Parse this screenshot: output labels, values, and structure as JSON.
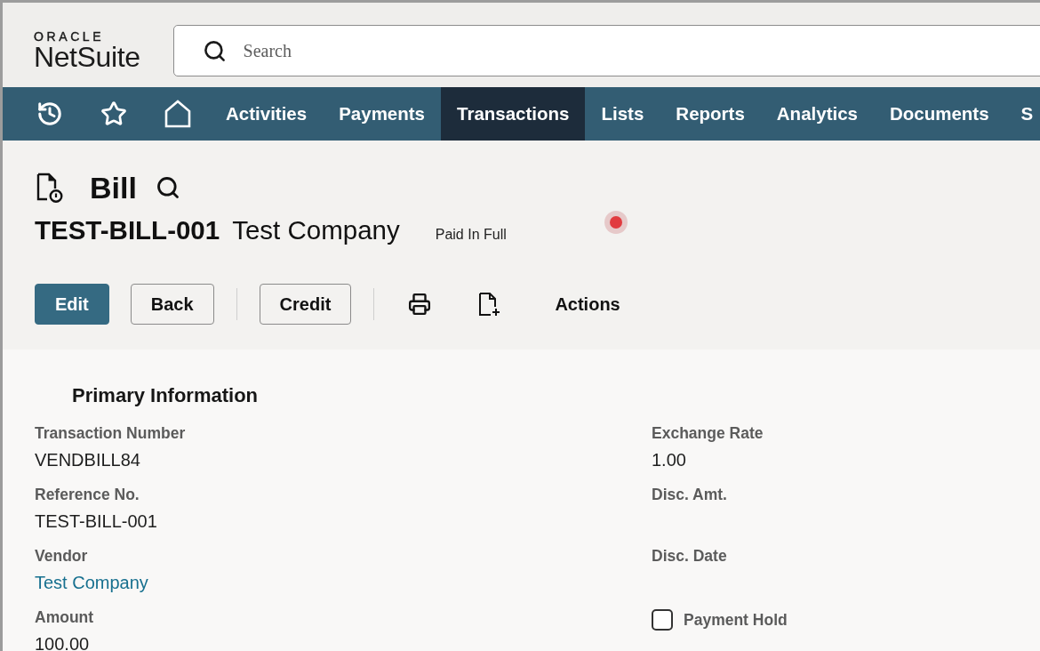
{
  "logo": {
    "caption": "ORACLE",
    "name": "NetSuite"
  },
  "search": {
    "placeholder": "Search"
  },
  "nav": {
    "items": [
      {
        "label": "Activities",
        "selected": false
      },
      {
        "label": "Payments",
        "selected": false
      },
      {
        "label": "Transactions",
        "selected": true
      },
      {
        "label": "Lists",
        "selected": false
      },
      {
        "label": "Reports",
        "selected": false
      },
      {
        "label": "Analytics",
        "selected": false
      },
      {
        "label": "Documents",
        "selected": false
      },
      {
        "label": "S",
        "selected": false
      }
    ]
  },
  "record": {
    "type": "Bill",
    "number": "TEST-BILL-001",
    "entity": "Test Company",
    "status": "Paid In Full"
  },
  "toolbar": {
    "buttons": [
      {
        "label": "Edit",
        "kind": "primary"
      },
      {
        "label": "Back",
        "kind": "secondary"
      },
      {
        "label": "Credit",
        "kind": "secondary"
      }
    ],
    "menu": "Actions"
  },
  "section": {
    "title": "Primary Information",
    "columns": [
      {
        "fields": [
          {
            "kind": "text",
            "label": "Transaction Number",
            "value": "VENDBILL84"
          },
          {
            "kind": "text",
            "label": "Reference No.",
            "value": "TEST-BILL-001"
          },
          {
            "kind": "link",
            "label": "Vendor",
            "value": "Test Company"
          },
          {
            "kind": "text",
            "label": "Amount",
            "value": "100.00"
          }
        ]
      },
      {
        "fields": [
          {
            "kind": "text",
            "label": "Exchange Rate",
            "value": "1.00"
          },
          {
            "kind": "text",
            "label": "Disc. Amt."
          },
          {
            "kind": "text",
            "label": "Disc. Date"
          },
          {
            "kind": "checkbox",
            "label": "Payment Hold",
            "checked": false
          }
        ]
      }
    ]
  }
}
